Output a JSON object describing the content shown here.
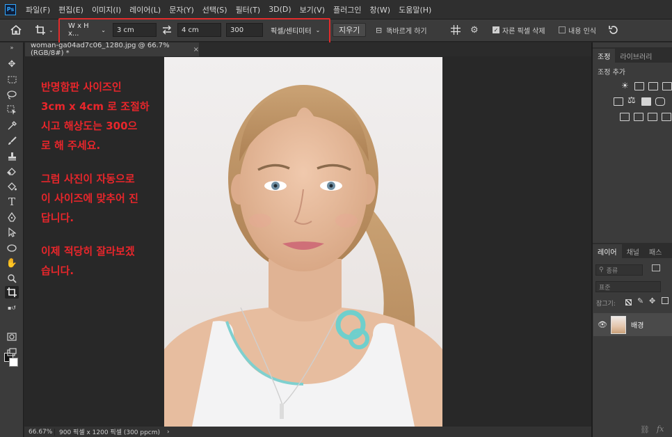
{
  "app": {
    "logo_text": "Ps"
  },
  "menu": [
    "파일(F)",
    "편집(E)",
    "이미지(I)",
    "레이어(L)",
    "문자(Y)",
    "선택(S)",
    "필터(T)",
    "3D(D)",
    "보기(V)",
    "플러그인",
    "창(W)",
    "도움말(H)"
  ],
  "options": {
    "ratio_preset": "W x H x...",
    "width": "3 cm",
    "height": "4 cm",
    "resolution": "300",
    "unit": "픽셀/센티미터",
    "clear_label": "지우기",
    "straighten_label": "똑바르게 하기",
    "delete_cropped_label": "자른 픽셀 삭제",
    "delete_cropped_checked": true,
    "content_aware_label": "내용 인식",
    "content_aware_checked": false,
    "highlight_color": "#e32b2b"
  },
  "document": {
    "tab_title": "woman-ga04ad7c06_1280.jpg @ 66.7% (RGB/8#) *",
    "close_glyph": "×",
    "zoom": "66.67%",
    "dimensions": "900 픽셀 x 1200 픽셀 (300 ppcm)",
    "status_arrow": "›"
  },
  "annotation": {
    "color": "#e8262b",
    "lines": [
      "반명함판 사이즈인",
      "3cm x 4cm 로 조절하",
      "시고 해상도는 300으",
      "로 해 주세요.",
      "그럼 사진이 자동으로",
      "이 사이즈에 맞추어 진",
      "답니다.",
      "이제 적당히 잘라보겠",
      "습니다."
    ]
  },
  "adjustments_panel": {
    "tabs": [
      "조정",
      "라이브러리"
    ],
    "subtitle": "조정 추가"
  },
  "layers_panel": {
    "tabs": [
      "레이어",
      "채널",
      "패스"
    ],
    "filter_placeholder": "종류",
    "blend_mode": "표준",
    "lock_label": "잠그기:",
    "layer_name": "배경"
  },
  "icons": [
    "home-icon",
    "crop-icon",
    "swap-icon",
    "grid-icon",
    "gear-icon",
    "reset-icon",
    "move-icon",
    "marquee-icon",
    "lasso-icon",
    "object-select-icon",
    "eyedropper-icon",
    "brush-icon",
    "stamp-icon",
    "eraser-icon",
    "paint-bucket-icon",
    "type-icon",
    "pen-icon",
    "path-select-icon",
    "ellipse-icon",
    "hand-icon",
    "zoom-icon",
    "eye-icon",
    "link-icon",
    "fx-icon"
  ]
}
